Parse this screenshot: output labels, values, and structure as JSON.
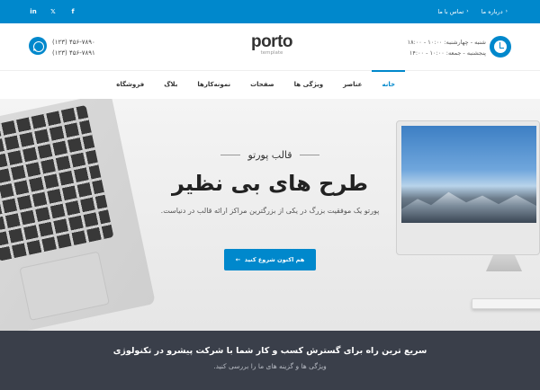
{
  "topbar": {
    "social": [
      "in",
      "𝕏",
      "f"
    ],
    "links": [
      {
        "label": "درباره ما"
      },
      {
        "label": "تماس با ما"
      }
    ]
  },
  "header": {
    "hours": [
      "شنبه - چهارشنبه: ۱۰:۰۰ - ۱۸:۰۰",
      "پنجشنبه - جمعه: ۱۰:۰۰ - ۱۴:۰۰"
    ],
    "logo": {
      "word": "porto",
      "sub": "template"
    },
    "phones": [
      "(۱۲۳) ۴۵۶-۷۸۹۰",
      "(۱۲۳) ۴۵۶-۷۸۹۱"
    ]
  },
  "nav": {
    "items": [
      {
        "label": "خانه",
        "active": true
      },
      {
        "label": "عناصر"
      },
      {
        "label": "ویژگی ها"
      },
      {
        "label": "صفحات"
      },
      {
        "label": "نمونه‌کارها"
      },
      {
        "label": "بلاگ"
      },
      {
        "label": "فروشگاه"
      }
    ]
  },
  "hero": {
    "eyebrow": "قالب پورتو",
    "headline": "طرح های بی نظیر",
    "description": "پورتو یک موفقیت بزرگ در یکی از بزرگترین مراکز ارائه قالب در دنیاست.",
    "cta": "هم اکنون شروع کنید"
  },
  "band": {
    "title": "سریع ترین راه برای گسترش کسب و کار شما با شرکت پیشرو در تکنولوژی",
    "subtitle": "ویژگی ها و گزینه های ما را بررسی کنید."
  },
  "colors": {
    "accent": "#0088cc",
    "band": "#3a3f4a"
  }
}
